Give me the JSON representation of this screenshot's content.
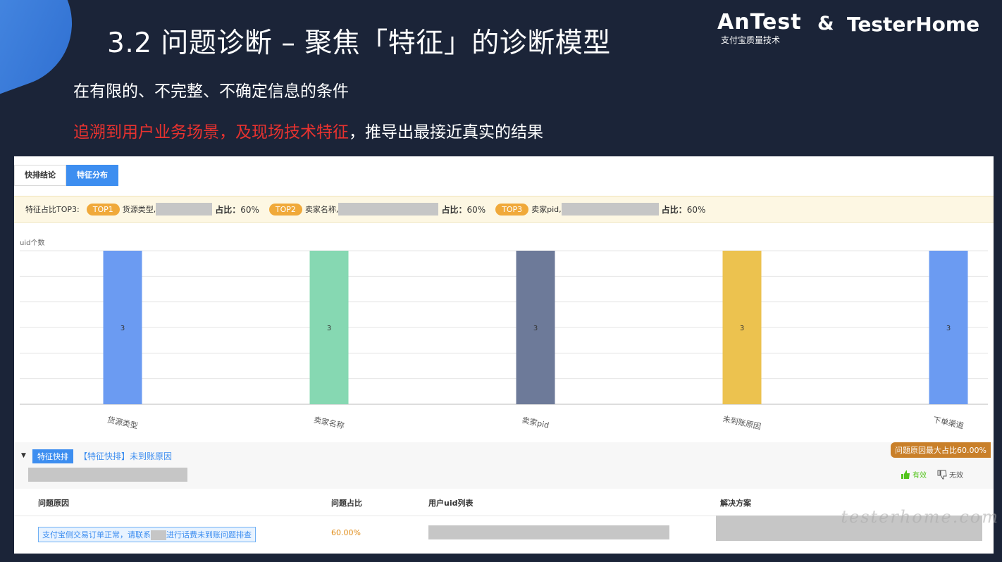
{
  "slide": {
    "title": "3.2 问题诊断 – 聚焦「特征」的诊断模型",
    "line1": "在有限的、不完整、不确定信息的条件",
    "line2_red": "追溯到用户业务场景，及现场技术特征",
    "line2_white": "，推导出最接近真实的结果"
  },
  "brand": {
    "antest": "AnTest",
    "antest_sub": "支付宝质量技术",
    "amp": "&",
    "testerhome": "TesterHome"
  },
  "tabs": [
    "快排结论",
    "特征分布"
  ],
  "top3": {
    "label": "特征占比TOP3:",
    "items": [
      {
        "tag": "TOP1",
        "name": "货源类型,",
        "ratio_label": "占比：",
        "ratio": "60%"
      },
      {
        "tag": "TOP2",
        "name": "卖家名称,",
        "ratio_label": "占比：",
        "ratio": "60%"
      },
      {
        "tag": "TOP3",
        "name": "卖家pid,",
        "ratio_label": "占比：",
        "ratio": "60%"
      }
    ]
  },
  "chart_data": {
    "type": "bar",
    "ylabel": "uid个数",
    "categories": [
      "货源类型",
      "卖家名称",
      "卖家pid",
      "未到账原因",
      "下单渠道"
    ],
    "values": [
      3,
      3,
      3,
      3,
      3
    ],
    "colors": [
      "#6b9bf2",
      "#86d8b2",
      "#6d7a99",
      "#ecc24f",
      "#6b9bf2"
    ],
    "ylim": [
      0,
      3
    ],
    "grid": true
  },
  "quick": {
    "tag": "特征快排",
    "title": "【特征快排】未到账原因",
    "max_badge": "问题原因最大占比60.00%",
    "valid": "有效",
    "invalid": "无效",
    "columns": [
      "问题原因",
      "问题占比",
      "用户uid列表",
      "解决方案"
    ],
    "row": {
      "reason_a": "支付宝侧交易订单正常，请联系",
      "reason_b": "进行话费未到账问题排查",
      "pct": "60.00%"
    }
  },
  "watermark": "testerhome.com"
}
